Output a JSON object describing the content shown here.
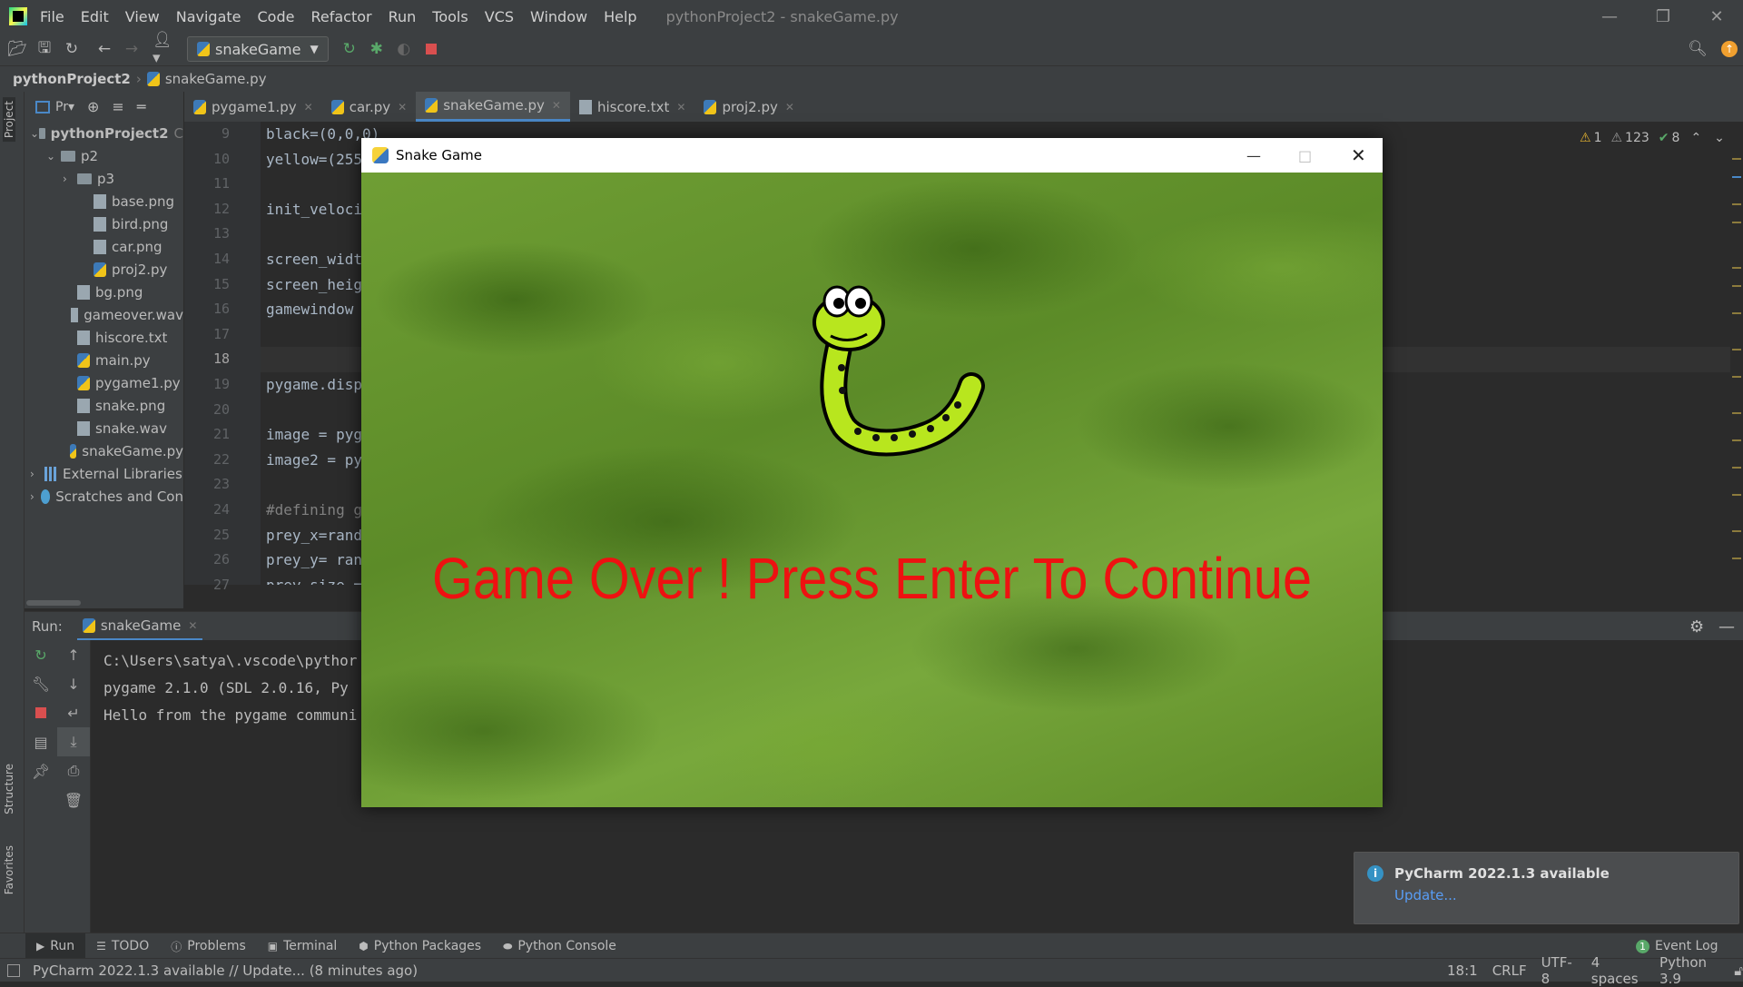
{
  "menu": {
    "items": [
      "File",
      "Edit",
      "View",
      "Navigate",
      "Code",
      "Refactor",
      "Run",
      "Tools",
      "VCS",
      "Window",
      "Help"
    ],
    "window_title": "pythonProject2 - snakeGame.py"
  },
  "toolbar": {
    "run_config": "snakeGame"
  },
  "breadcrumb": {
    "project": "pythonProject2",
    "file": "snakeGame.py"
  },
  "project_panel": {
    "label": "Project",
    "tree": [
      {
        "label": "pythonProject2",
        "level": 0,
        "type": "folder",
        "expanded": true,
        "suffix": "C"
      },
      {
        "label": "p2",
        "level": 1,
        "type": "folder",
        "expanded": true
      },
      {
        "label": "p3",
        "level": 2,
        "type": "folder",
        "expanded": false
      },
      {
        "label": "base.png",
        "level": 3,
        "type": "file"
      },
      {
        "label": "bird.png",
        "level": 3,
        "type": "file"
      },
      {
        "label": "car.png",
        "level": 3,
        "type": "file"
      },
      {
        "label": "proj2.py",
        "level": 3,
        "type": "py"
      },
      {
        "label": "bg.png",
        "level": 2,
        "type": "file"
      },
      {
        "label": "gameover.wav",
        "level": 2,
        "type": "file"
      },
      {
        "label": "hiscore.txt",
        "level": 2,
        "type": "file"
      },
      {
        "label": "main.py",
        "level": 2,
        "type": "py"
      },
      {
        "label": "pygame1.py",
        "level": 2,
        "type": "py"
      },
      {
        "label": "snake.png",
        "level": 2,
        "type": "file"
      },
      {
        "label": "snake.wav",
        "level": 2,
        "type": "file"
      },
      {
        "label": "snakeGame.py",
        "level": 2,
        "type": "py"
      },
      {
        "label": "External Libraries",
        "level": 0,
        "type": "lib",
        "expanded": false
      },
      {
        "label": "Scratches and Con",
        "level": 0,
        "type": "scratch",
        "expanded": false
      }
    ]
  },
  "editor_tabs": [
    {
      "label": "pygame1.py",
      "active": false
    },
    {
      "label": "car.py",
      "active": false
    },
    {
      "label": "snakeGame.py",
      "active": true
    },
    {
      "label": "hiscore.txt",
      "active": false
    },
    {
      "label": "proj2.py",
      "active": false
    }
  ],
  "editor": {
    "lines": [
      {
        "n": "9",
        "text": "black=(0,0,0)"
      },
      {
        "n": "10",
        "text": "yellow=(255"
      },
      {
        "n": "11",
        "text": ""
      },
      {
        "n": "12",
        "text": "init_veloci"
      },
      {
        "n": "13",
        "text": ""
      },
      {
        "n": "14",
        "text": "screen_widt"
      },
      {
        "n": "15",
        "text": "screen_heig"
      },
      {
        "n": "16",
        "text": "gamewindow"
      },
      {
        "n": "17",
        "text": ""
      },
      {
        "n": "18",
        "text": "",
        "current": true
      },
      {
        "n": "19",
        "text": "pygame.disp"
      },
      {
        "n": "20",
        "text": ""
      },
      {
        "n": "21",
        "text": "image = pyg"
      },
      {
        "n": "22",
        "text": "image2 = py"
      },
      {
        "n": "23",
        "text": ""
      },
      {
        "n": "24",
        "text": "#defining g",
        "comment": true
      },
      {
        "n": "25",
        "text": "prey_x=rand"
      },
      {
        "n": "26",
        "text": "prey_y= ran"
      },
      {
        "n": "27",
        "text": "prey_size ="
      }
    ],
    "inspections": {
      "warnings": "1",
      "weak_warnings": "123",
      "typos": "8"
    }
  },
  "run_panel": {
    "label": "Run:",
    "tab": "snakeGame",
    "console": [
      "C:\\Users\\satya\\.vscode\\pythor",
      "pygame 2.1.0 (SDL 2.0.16, Py",
      "Hello from the pygame communi"
    ]
  },
  "side_tabs": {
    "structure": "Structure",
    "favorites": "Favorites"
  },
  "bottom_tabs": [
    "Run",
    "TODO",
    "Problems",
    "Terminal",
    "Python Packages",
    "Python Console"
  ],
  "event_log": {
    "count": "1",
    "label": "Event Log"
  },
  "notification": {
    "title": "PyCharm 2022.1.3 available",
    "link": "Update..."
  },
  "status_bar": {
    "message": "PyCharm 2022.1.3 available // Update... (8 minutes ago)",
    "position": "18:1",
    "line_sep": "CRLF",
    "encoding": "UTF-8",
    "indent": "4 spaces",
    "interpreter": "Python 3.9"
  },
  "game_window": {
    "title": "Snake Game",
    "message": "Game Over ! Press Enter To Continue"
  },
  "colors": {
    "ide_bg": "#2b2b2b",
    "panel_bg": "#3c3f41",
    "accent": "#4a88c7",
    "game_text": "#ee1111",
    "grass": "#6a9a30"
  }
}
